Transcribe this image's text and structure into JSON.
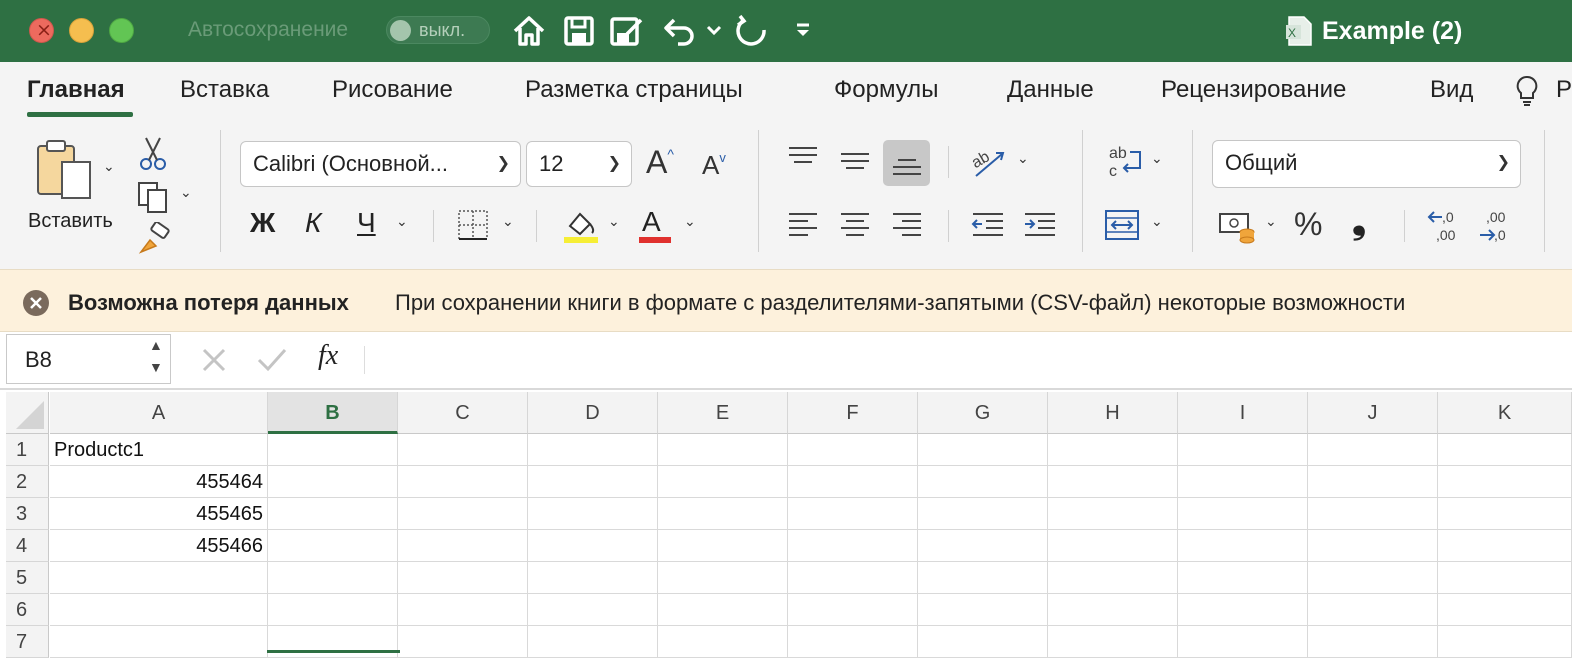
{
  "titlebar": {
    "autosave_label": "Автосохранение",
    "autosave_state": "выкл.",
    "doc_title": "Example (2)",
    "doc_icon_letter": "X",
    "colors": {
      "background": "#2e7043",
      "text": "#ffffff"
    }
  },
  "quick_access": [
    "home-icon",
    "save-icon",
    "save-as-icon",
    "undo-icon",
    "undo-dropdown-icon",
    "redo-icon",
    "customize-toolbar-icon"
  ],
  "tabs": [
    {
      "label": "Главная",
      "active": true
    },
    {
      "label": "Вставка"
    },
    {
      "label": "Рисование"
    },
    {
      "label": "Разметка страницы"
    },
    {
      "label": "Формулы"
    },
    {
      "label": "Данные"
    },
    {
      "label": "Рецензирование"
    },
    {
      "label": "Вид"
    },
    {
      "label": "Р"
    }
  ],
  "ribbon": {
    "paste_label": "Вставить",
    "font_name": "Calibri (Основной...",
    "font_size": "12",
    "bold_label": "Ж",
    "italic_label": "К",
    "underline_label": "Ч",
    "number_format": "Общий",
    "percent_label": "%",
    "comma_label": "❟",
    "font_color_label": "A",
    "increase_font": "A",
    "decrease_font": "A",
    "increase_decimal": ",0\n,00",
    "decrease_decimal": ",00\n,0"
  },
  "notification": {
    "title": "Возможна потеря данных",
    "message": "При сохранении книги в формате с разделителями-запятыми (CSV-файл) некоторые возможности"
  },
  "formula_bar": {
    "name_box": "B8",
    "fx_label": "fx",
    "formula": ""
  },
  "sheet": {
    "columns": [
      "A",
      "B",
      "C",
      "D",
      "E",
      "F",
      "G",
      "H",
      "I",
      "J",
      "K"
    ],
    "selected_column": "B",
    "rows": [
      "1",
      "2",
      "3",
      "4",
      "5",
      "6",
      "7"
    ],
    "cells": {
      "A1": "Productc1",
      "A2": "455464",
      "A3": "455465",
      "A4": "455466"
    }
  }
}
